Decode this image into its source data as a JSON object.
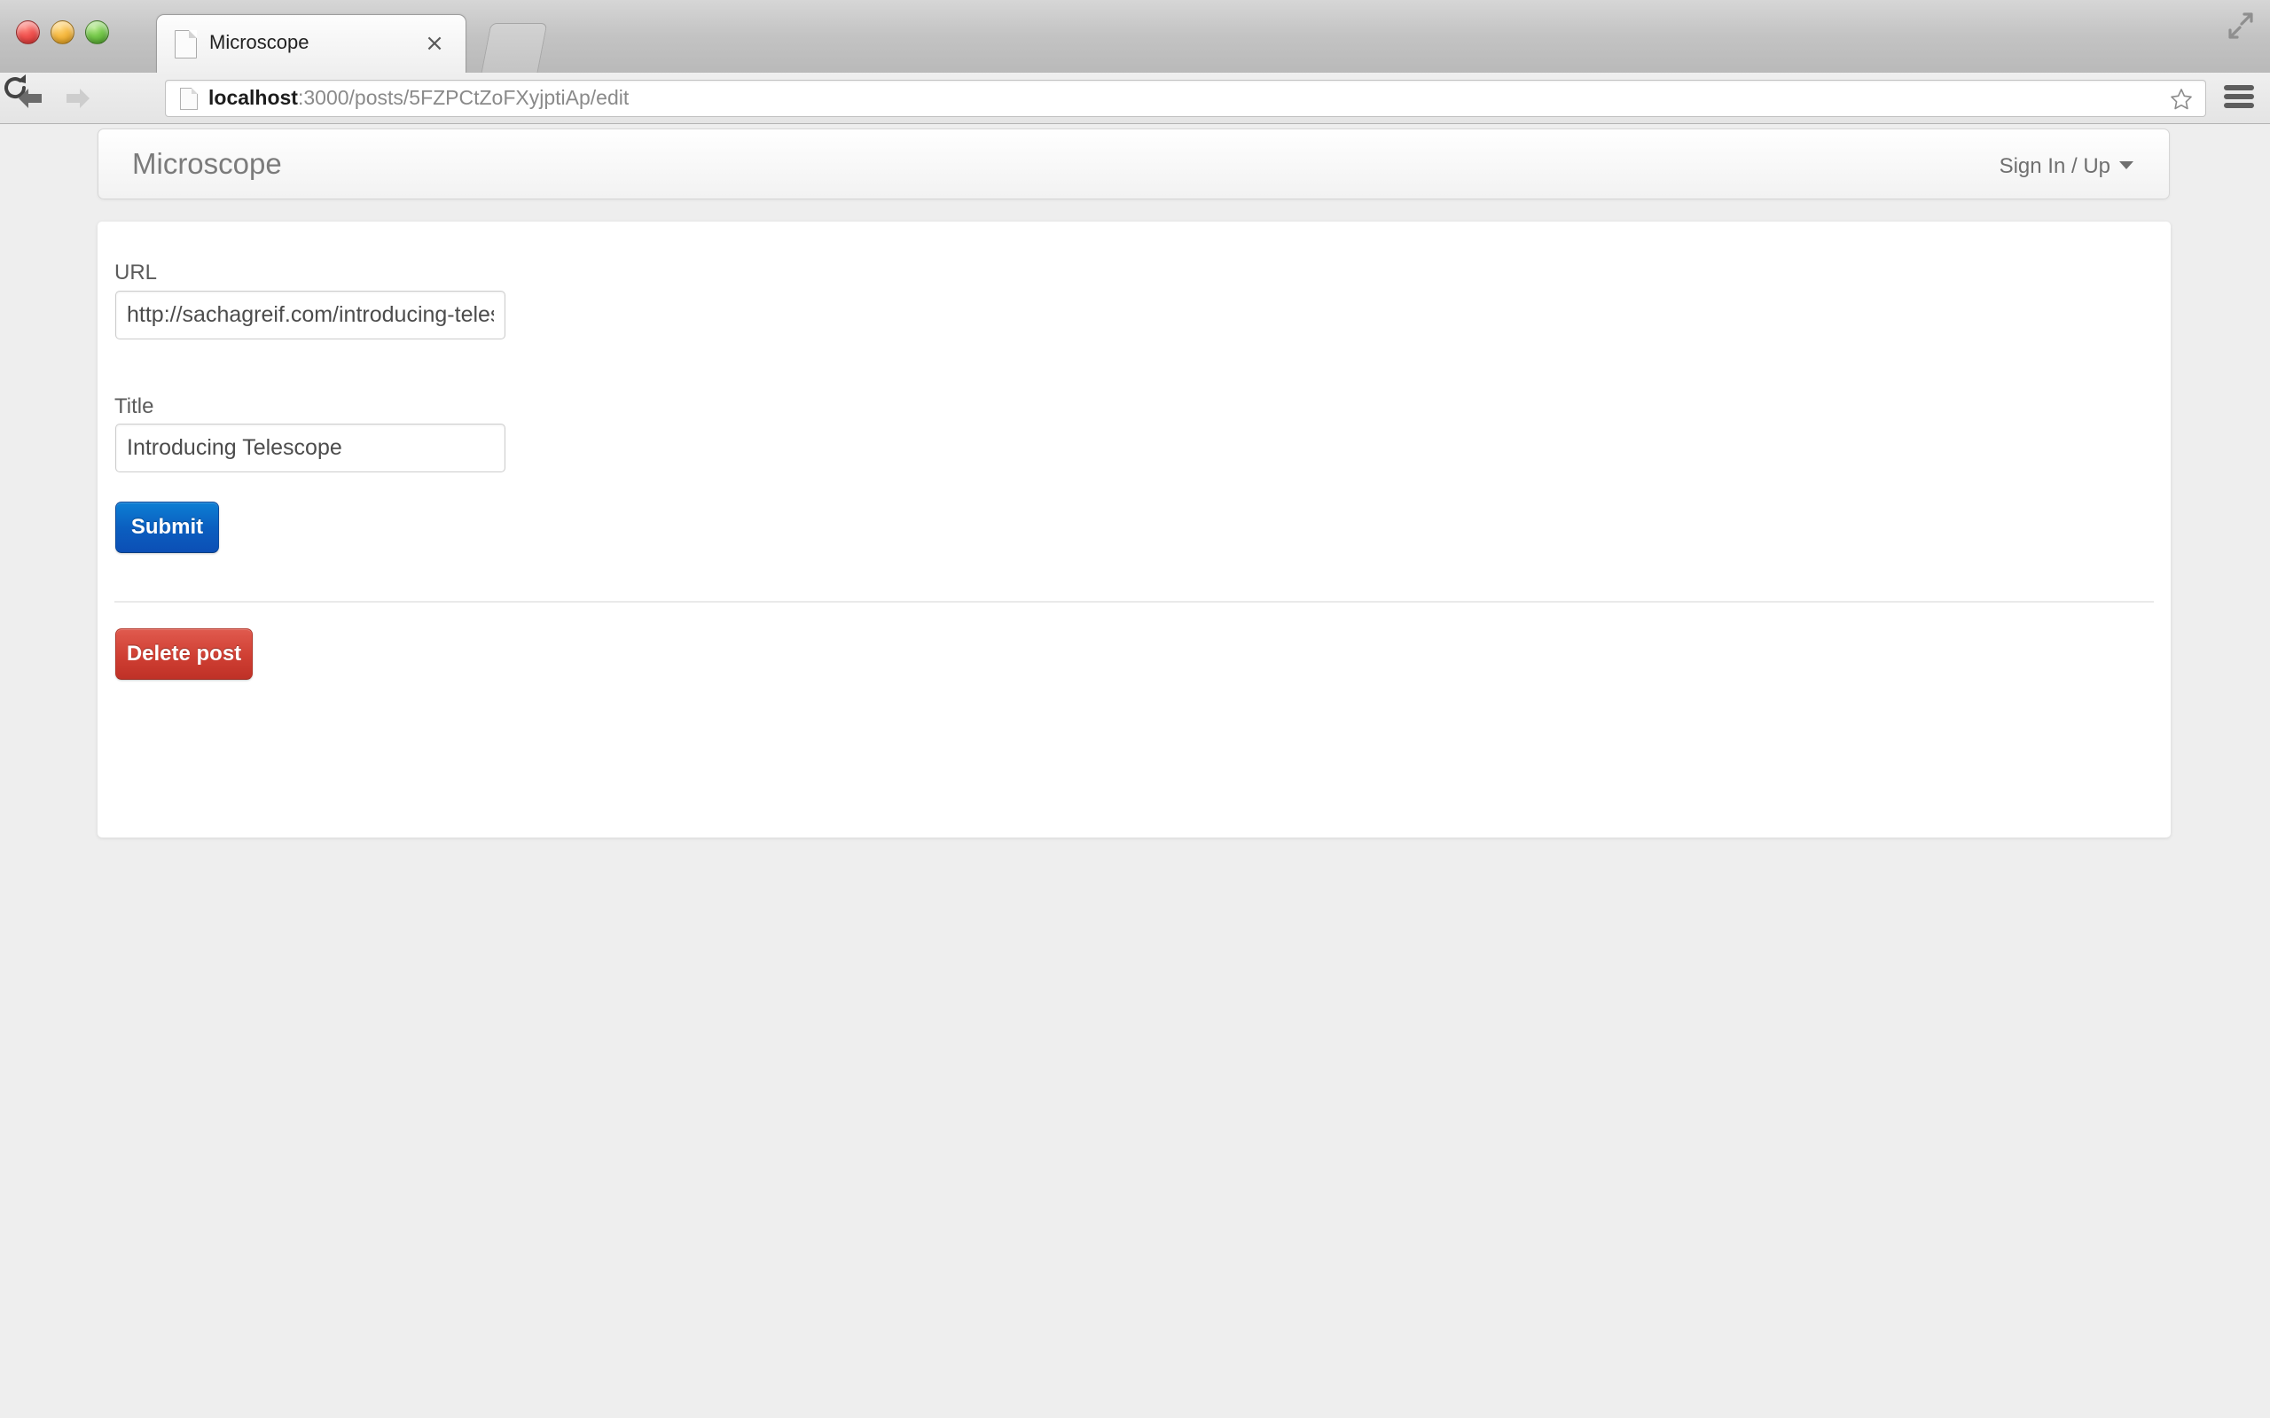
{
  "browser": {
    "window_controls": [
      "close",
      "minimize",
      "zoom"
    ],
    "tab": {
      "title": "Microscope",
      "favicon": "page-icon",
      "close_label": "×"
    },
    "new_tab_label": "",
    "toolbar": {
      "back_icon": "back-arrow-icon",
      "forward_icon": "forward-arrow-icon",
      "reload_icon": "reload-icon",
      "menu_icon": "hamburger-menu-icon",
      "bookmark_icon": "star-icon",
      "expand_icon": "fullscreen-expand-icon"
    },
    "omnibox": {
      "url_host": "localhost",
      "url_rest": ":3000/posts/5FZPCtZoFXyjptiAp/edit",
      "full_url": "localhost:3000/posts/5FZPCtZoFXyjptiAp/edit"
    }
  },
  "page": {
    "navbar": {
      "brand": "Microscope",
      "account_menu": "Sign In / Up"
    },
    "form": {
      "url_label": "URL",
      "url_value": "http://sachagreif.com/introducing-telescope",
      "url_placeholder": "",
      "title_label": "Title",
      "title_value": "Introducing Telescope",
      "title_placeholder": "",
      "submit_label": "Submit"
    },
    "actions": {
      "delete_label": "Delete post"
    },
    "colors": {
      "background": "#eeeeee",
      "panel": "#ffffff",
      "submit_blue": "#0b5fc0",
      "delete_red": "#cf3f33",
      "label_text": "#5b5b5b",
      "brand_text": "#7b7b7b"
    }
  }
}
